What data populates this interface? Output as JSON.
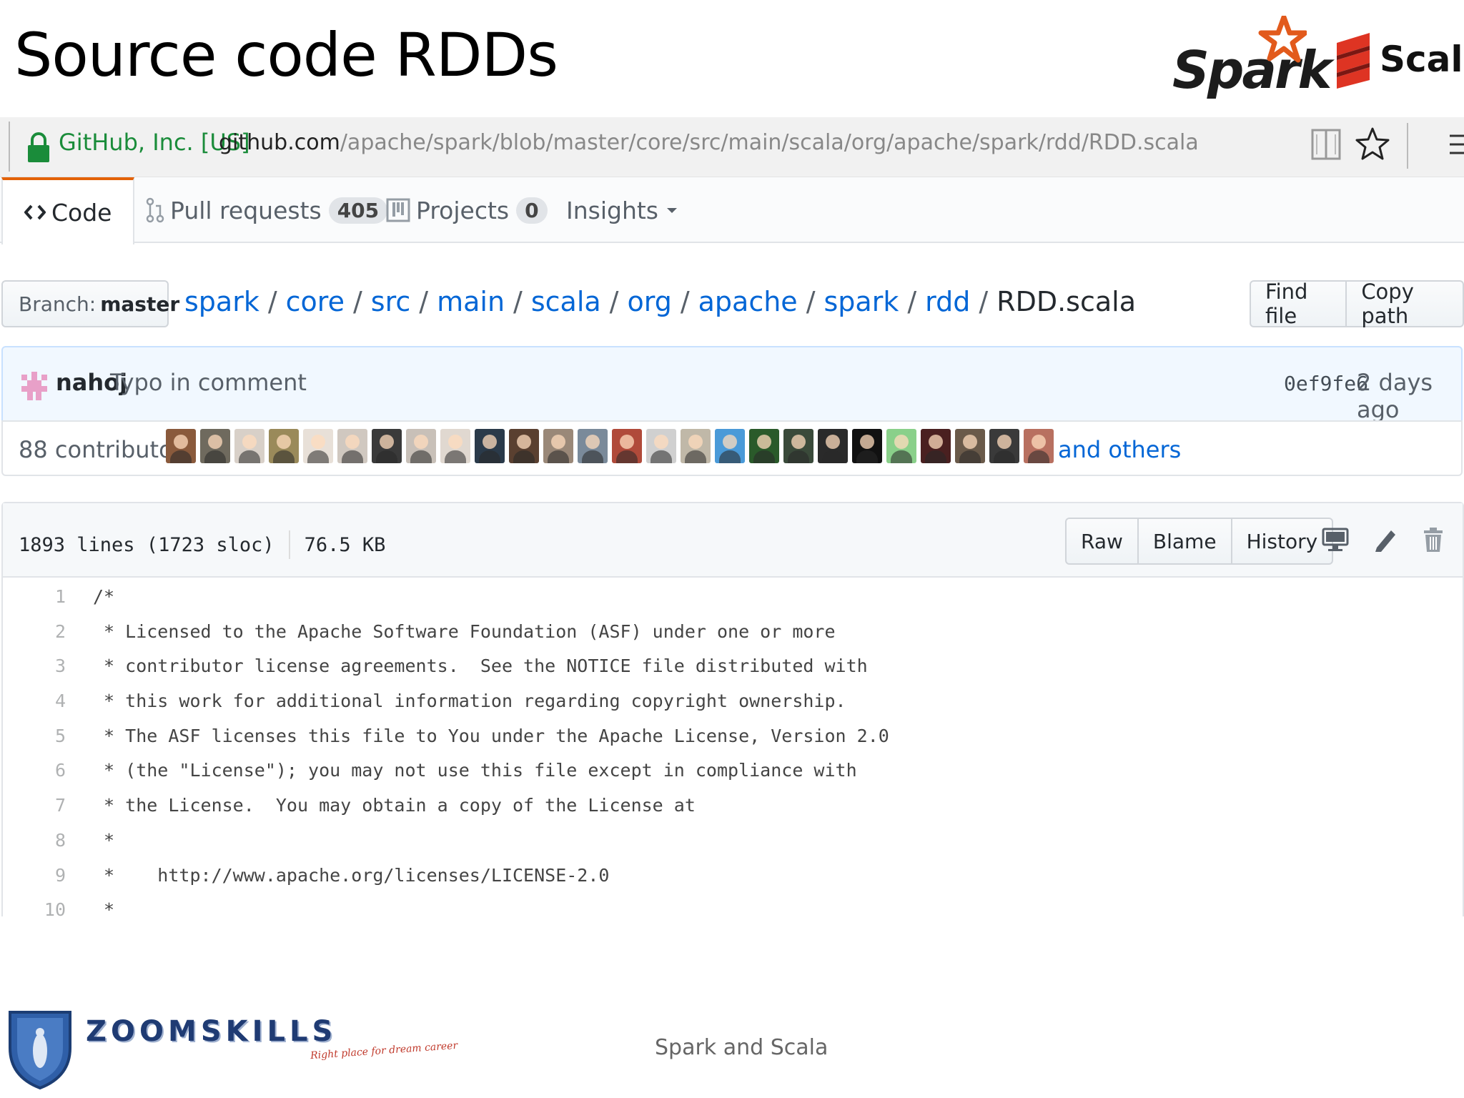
{
  "slide": {
    "title": "Source code RDDs",
    "logos": {
      "spark": "Spark",
      "scala": "Scala"
    },
    "footer_text": "Spark and Scala",
    "brand": {
      "name": "ZOOMSKILLS",
      "tagline": "Right place for dream career"
    }
  },
  "browser": {
    "site_identity": "GitHub, Inc. [US]",
    "url_host": "github.com",
    "url_path": "/apache/spark/blob/master/core/src/main/scala/org/apache/spark/rdd/RDD.scala"
  },
  "tabs": [
    {
      "label": "Code",
      "selected": true
    },
    {
      "label": "Pull requests",
      "count": "405"
    },
    {
      "label": "Projects",
      "count": "0"
    },
    {
      "label": "Insights"
    }
  ],
  "branch": {
    "prefix": "Branch:",
    "name": "master"
  },
  "breadcrumb": [
    "spark",
    "core",
    "src",
    "main",
    "scala",
    "org",
    "apache",
    "spark",
    "rdd"
  ],
  "breadcrumb_final": "RDD.scala",
  "buttons": {
    "find_file": "Find file",
    "copy_path": "Copy path"
  },
  "commit": {
    "author": "nahoj",
    "message": "Typo in comment",
    "sha": "0ef9fe6",
    "date": "2 days ago"
  },
  "contributors": {
    "count_text": "88 contributors",
    "others_text": "and others",
    "avatar_colors": [
      "#8a5a3c",
      "#6f6a5e",
      "#d8d0c8",
      "#9a8a5a",
      "#e8e0d8",
      "#d0c8c0",
      "#3a3a3a",
      "#c8c0b8",
      "#e0d8d0",
      "#2a3a4a",
      "#5a4030",
      "#9a8878",
      "#7a8a9a",
      "#b04a3a",
      "#d0d0d0",
      "#c0b8a8",
      "#4a9ad8",
      "#2a5a2a",
      "#3a4a3a",
      "#2a2a2a",
      "#111111",
      "#8ad08a",
      "#4a2020",
      "#6a5a4a",
      "#3a3a3a",
      "#b87060"
    ]
  },
  "file": {
    "lines_info": "1893 lines (1723 sloc)",
    "size": "76.5 KB",
    "buttons": {
      "raw": "Raw",
      "blame": "Blame",
      "history": "History"
    },
    "code": [
      {
        "n": "1",
        "text": "/*"
      },
      {
        "n": "2",
        "text": " * Licensed to the Apache Software Foundation (ASF) under one or more"
      },
      {
        "n": "3",
        "text": " * contributor license agreements.  See the NOTICE file distributed with"
      },
      {
        "n": "4",
        "text": " * this work for additional information regarding copyright ownership."
      },
      {
        "n": "5",
        "text": " * The ASF licenses this file to You under the Apache License, Version 2.0"
      },
      {
        "n": "6",
        "text": " * (the \"License\"); you may not use this file except in compliance with"
      },
      {
        "n": "7",
        "text": " * the License.  You may obtain a copy of the License at"
      },
      {
        "n": "8",
        "text": " *"
      },
      {
        "n": "9",
        "text": " *    http://www.apache.org/licenses/LICENSE-2.0"
      },
      {
        "n": "10",
        "text": " *"
      }
    ]
  }
}
